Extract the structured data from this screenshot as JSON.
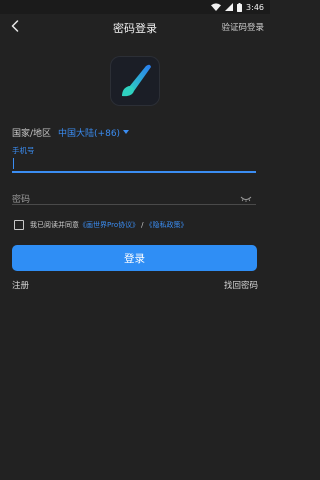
{
  "status_bar": {
    "time": "3:46"
  },
  "header": {
    "title": "密码登录",
    "code_login": "验证码登录"
  },
  "form": {
    "region_label": "国家/地区",
    "region_value": "中国大陆(+86)",
    "phone_label": "手机号",
    "phone_value": "",
    "password_placeholder": "密码"
  },
  "agreement": {
    "prefix": "我已阅读并同意",
    "user_agreement": "《画世界Pro协议》",
    "separator": "/",
    "privacy_policy": "《隐私政策》"
  },
  "actions": {
    "login": "登录",
    "register": "注册",
    "forgot_password": "找回密码"
  },
  "colors": {
    "accent": "#2f8ef5",
    "background": "#222222"
  },
  "icons": {
    "back": "back-arrow-icon",
    "eye": "eye-closed-icon",
    "logo": "brush-logo-icon",
    "region_caret": "caret-down-icon"
  }
}
